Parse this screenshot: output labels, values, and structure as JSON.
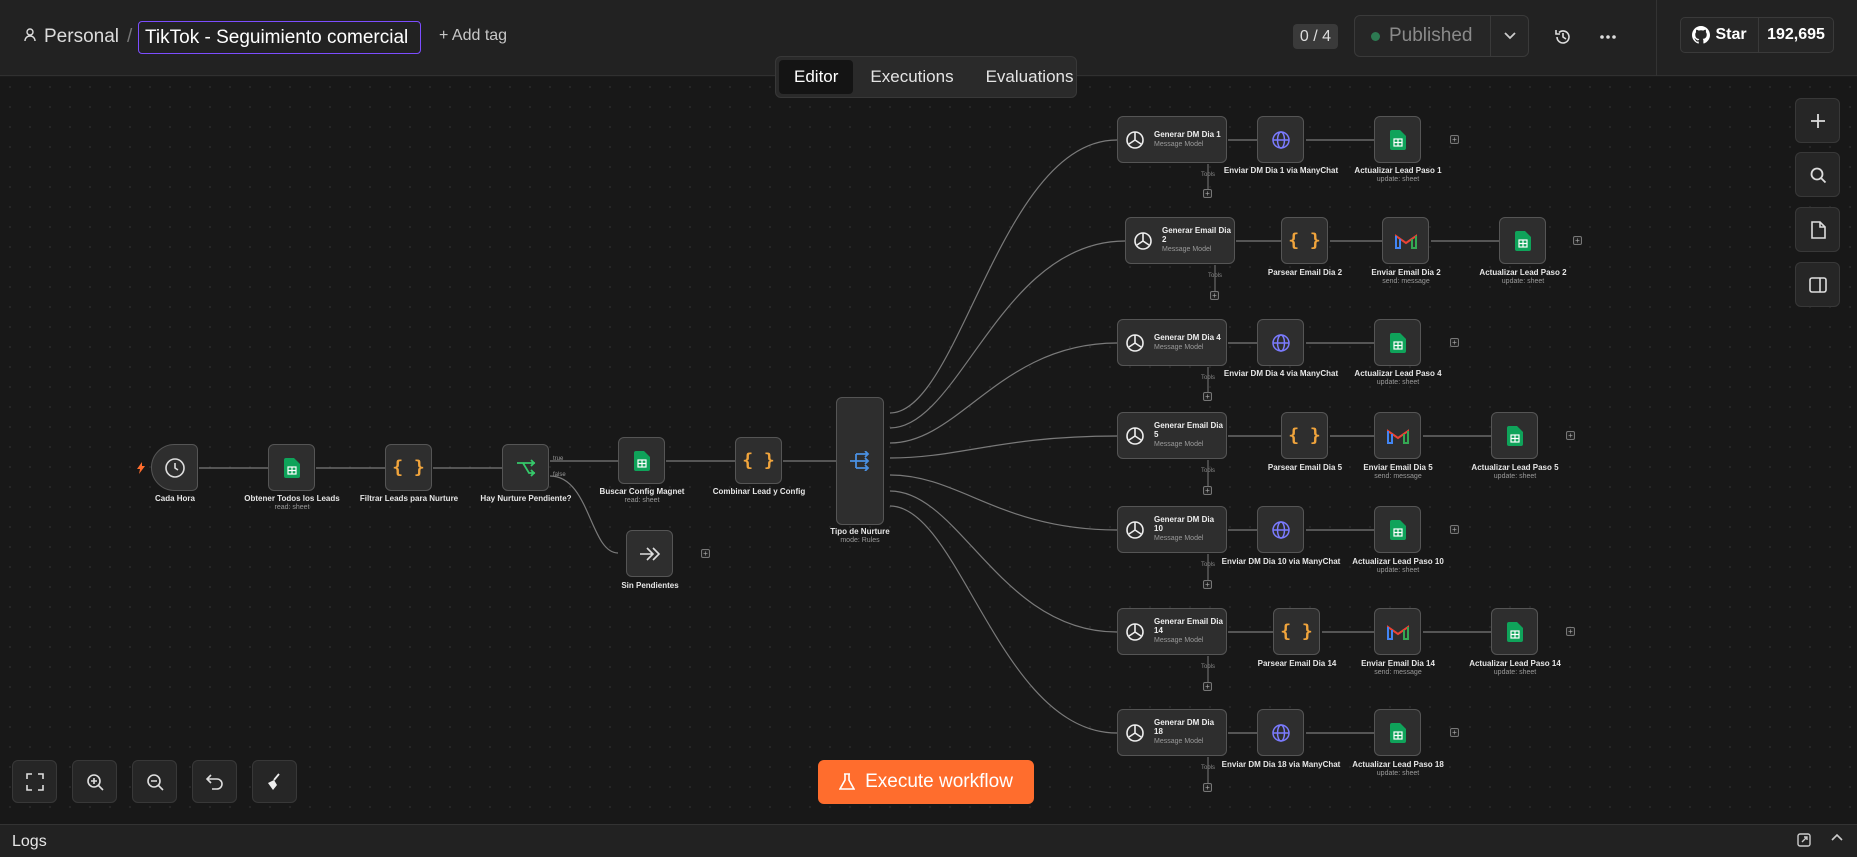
{
  "header": {
    "project_label": "Personal",
    "separator": "/",
    "workflow_title": "TikTok -  Seguimiento comercial",
    "add_tag_label": "+ Add tag",
    "activation_counter": "0 / 4",
    "published_label": "Published",
    "github_star_label": "Star",
    "github_star_count": "192,695"
  },
  "tabs": [
    {
      "label": "Editor",
      "active": true
    },
    {
      "label": "Executions",
      "active": false
    },
    {
      "label": "Evaluations",
      "active": false
    }
  ],
  "nodes": {
    "cada_hora": {
      "label": "Cada Hora",
      "icon": "clock-icon"
    },
    "obtener_leads": {
      "label": "Obtener Todos los Leads",
      "sub": "read: sheet",
      "icon": "sheets-icon"
    },
    "filtrar_leads": {
      "label": "Filtrar Leads para Nurture",
      "icon": "code-braces-icon"
    },
    "hay_nurture": {
      "label": "Hay Nurture Pendiente?",
      "icon": "if-branch-icon",
      "out_true": "true",
      "out_false": "false"
    },
    "buscar_config": {
      "label": "Buscar Config Magnet",
      "sub": "read: sheet",
      "icon": "sheets-icon"
    },
    "sin_pendientes": {
      "label": "Sin Pendientes",
      "icon": "noop-icon"
    },
    "combinar": {
      "label": "Combinar Lead y Config",
      "icon": "code-braces-icon"
    },
    "tipo_nurture": {
      "label": "Tipo de Nurture",
      "sub": "mode: Rules",
      "icon": "switch-icon"
    }
  },
  "branches": [
    {
      "ai_title": "Generar DM Dia 1",
      "ai_sub": "Message Model",
      "tools": "Tools",
      "steps": [
        {
          "label": "Enviar DM Dia 1 via ManyChat",
          "sub": "",
          "icon": "http-globe-icon"
        },
        {
          "label": "Actualizar Lead Paso 1",
          "sub": "update: sheet",
          "icon": "sheets-icon"
        }
      ]
    },
    {
      "ai_title": "Generar Email Dia 2",
      "ai_sub": "Message Model",
      "tools": "Tools",
      "steps": [
        {
          "label": "Parsear Email Dia 2",
          "sub": "",
          "icon": "code-braces-icon"
        },
        {
          "label": "Enviar Email Dia 2",
          "sub": "send: message",
          "icon": "gmail-icon"
        },
        {
          "label": "Actualizar Lead Paso 2",
          "sub": "update: sheet",
          "icon": "sheets-icon"
        }
      ]
    },
    {
      "ai_title": "Generar DM Dia 4",
      "ai_sub": "Message Model",
      "tools": "Tools",
      "steps": [
        {
          "label": "Enviar DM Dia 4 via ManyChat",
          "sub": "",
          "icon": "http-globe-icon"
        },
        {
          "label": "Actualizar Lead Paso 4",
          "sub": "update: sheet",
          "icon": "sheets-icon"
        }
      ]
    },
    {
      "ai_title": "Generar Email Dia 5",
      "ai_sub": "Message Model",
      "tools": "Tools",
      "steps": [
        {
          "label": "Parsear Email Dia 5",
          "sub": "",
          "icon": "code-braces-icon"
        },
        {
          "label": "Enviar Email Dia 5",
          "sub": "send: message",
          "icon": "gmail-icon"
        },
        {
          "label": "Actualizar Lead Paso 5",
          "sub": "update: sheet",
          "icon": "sheets-icon"
        }
      ]
    },
    {
      "ai_title": "Generar DM Dia 10",
      "ai_sub": "Message Model",
      "tools": "Tools",
      "steps": [
        {
          "label": "Enviar DM Dia 10 via ManyChat",
          "sub": "",
          "icon": "http-globe-icon"
        },
        {
          "label": "Actualizar Lead Paso 10",
          "sub": "update: sheet",
          "icon": "sheets-icon"
        }
      ]
    },
    {
      "ai_title": "Generar Email Dia 14",
      "ai_sub": "Message Model",
      "tools": "Tools",
      "steps": [
        {
          "label": "Parsear Email Dia 14",
          "sub": "",
          "icon": "code-braces-icon"
        },
        {
          "label": "Enviar Email Dia 14",
          "sub": "send: message",
          "icon": "gmail-icon"
        },
        {
          "label": "Actualizar Lead Paso 14",
          "sub": "update: sheet",
          "icon": "sheets-icon"
        }
      ]
    },
    {
      "ai_title": "Generar DM Dia 18",
      "ai_sub": "Message Model",
      "tools": "Tools",
      "steps": [
        {
          "label": "Enviar DM Dia 18 via ManyChat",
          "sub": "",
          "icon": "http-globe-icon"
        },
        {
          "label": "Actualizar Lead Paso 18",
          "sub": "update: sheet",
          "icon": "sheets-icon"
        }
      ]
    }
  ],
  "execute_button_label": "Execute workflow",
  "logs_label": "Logs",
  "colors": {
    "accent_orange": "#ff6d2d",
    "title_border": "#7c4dff",
    "sheets_green": "#0fa35a",
    "code_orange": "#f0a43c",
    "route_blue": "#4a90e2",
    "http_blue": "#7b7bff"
  }
}
